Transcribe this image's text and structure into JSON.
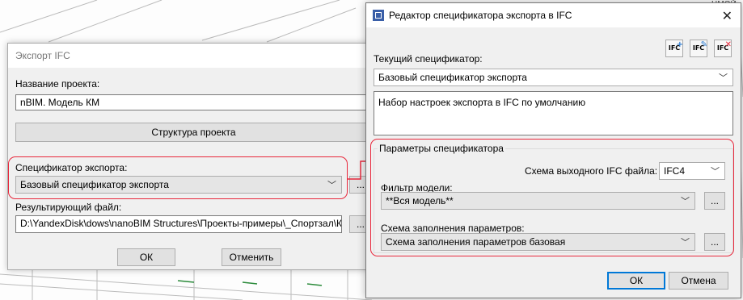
{
  "export_dialog": {
    "title": "Экспорт IFC",
    "project_name_label": "Название проекта:",
    "project_name_value": "nBIM. Модель КМ",
    "project_structure_button": "Структура проекта",
    "spec_label": "Спецификатор экспорта:",
    "spec_value": "Базовый спецификатор экспорта",
    "spec_more": "...",
    "result_file_label": "Результирующий файл:",
    "result_file_value": "D:\\YandexDisk\\dows\\nanoBIM Structures\\Проекты-примеры\\_Спортзал\\КР.NBIM",
    "result_more": "...",
    "ok": "ОК",
    "cancel": "Отменить"
  },
  "editor_dialog": {
    "title": "Редактор спецификатора экспорта в IFC",
    "close": "✕",
    "current_label": "Текущий спецификатор:",
    "current_value": "Базовый спецификатор экспорта",
    "description": "Набор настроек экспорта в IFC по умолчанию",
    "toolbar": {
      "new": "IFC",
      "edit": "IFC",
      "delete": "IFC"
    },
    "group_title": "Параметры спецификатора",
    "schema_label": "Схема выходного IFC файла:",
    "schema_value": "IFC4",
    "filter_label": "Фильтр модели:",
    "filter_value": "**Вся модель**",
    "filter_more": "...",
    "fill_label": "Схема заполнения параметров:",
    "fill_value": "Схема заполнения параметров базовая",
    "fill_more": "...",
    "ok": "ОК",
    "cancel": "Отмена"
  },
  "colors": {
    "highlight": "#e8283c",
    "default_border": "#0078d7"
  },
  "background": {
    "right_label": "ЦМОЙ"
  }
}
